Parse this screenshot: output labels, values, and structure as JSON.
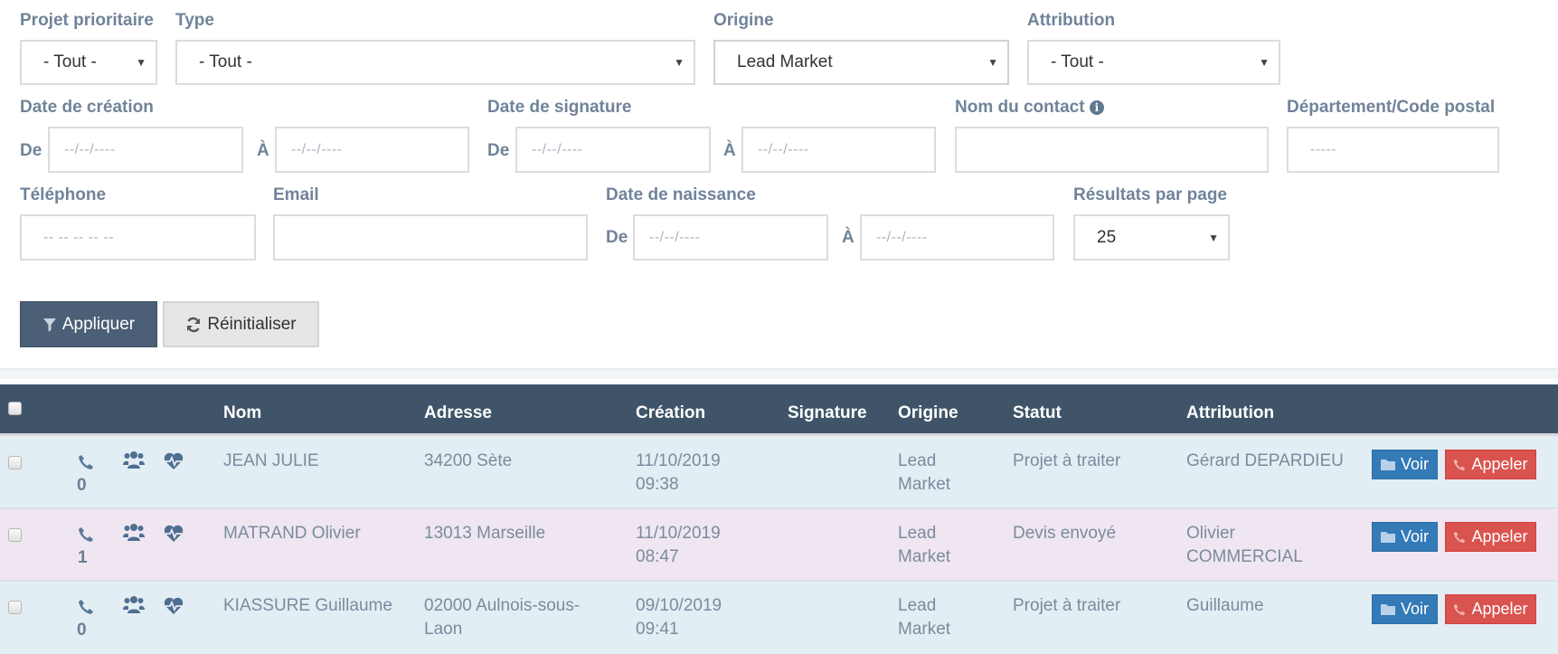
{
  "filters": {
    "projet_prioritaire": {
      "label": "Projet prioritaire",
      "value": "- Tout -"
    },
    "type": {
      "label": "Type",
      "value": "- Tout -"
    },
    "origine": {
      "label": "Origine",
      "value": "Lead Market"
    },
    "attribution": {
      "label": "Attribution",
      "value": "- Tout -"
    },
    "date_creation": {
      "label": "Date de création",
      "from_label": "De",
      "to_label": "À",
      "from_placeholder": "--/--/----",
      "to_placeholder": "--/--/----"
    },
    "date_signature": {
      "label": "Date de signature",
      "from_label": "De",
      "to_label": "À",
      "from_placeholder": "--/--/----",
      "to_placeholder": "--/--/----"
    },
    "nom_contact": {
      "label": "Nom du contact",
      "info_icon": "info-circle-icon",
      "value": ""
    },
    "departement": {
      "label": "Département/Code postal",
      "placeholder": "-----"
    },
    "telephone": {
      "label": "Téléphone",
      "placeholder": "-- -- -- -- --"
    },
    "email": {
      "label": "Email",
      "value": ""
    },
    "date_naissance": {
      "label": "Date de naissance",
      "from_label": "De",
      "to_label": "À",
      "from_placeholder": "--/--/----",
      "to_placeholder": "--/--/----"
    },
    "resultats_par_page": {
      "label": "Résultats par page",
      "value": "25"
    }
  },
  "actions": {
    "apply_label": "Appliquer",
    "reset_label": "Réinitialiser"
  },
  "table": {
    "headers": [
      "Nom",
      "Adresse",
      "Création",
      "Signature",
      "Origine",
      "Statut",
      "Attribution"
    ],
    "rows": [
      {
        "calls": "0",
        "nom": "JEAN JULIE",
        "adresse": "34200 Sète",
        "creation_date": "11/10/2019",
        "creation_time": "09:38",
        "signature": "",
        "origine1": "Lead",
        "origine2": "Market",
        "statut": "Projet à traiter",
        "attribution1": "Gérard DEPARDIEU",
        "attribution2": "",
        "voir": "Voir",
        "appeler": "Appeler"
      },
      {
        "calls": "1",
        "nom": "MATRAND Olivier",
        "adresse": "13013 Marseille",
        "creation_date": "11/10/2019",
        "creation_time": "08:47",
        "signature": "",
        "origine1": "Lead",
        "origine2": "Market",
        "statut": "Devis envoyé",
        "attribution1": "Olivier",
        "attribution2": "COMMERCIAL",
        "voir": "Voir",
        "appeler": "Appeler"
      },
      {
        "calls": "0",
        "nom": "KIASSURE Guillaume",
        "adresse": "02000 Aulnois-sous-",
        "adresse2": "Laon",
        "creation_date": "09/10/2019",
        "creation_time": "09:41",
        "signature": "",
        "origine1": "Lead",
        "origine2": "Market",
        "statut": "Projet à traiter",
        "attribution1": "Guillaume",
        "attribution2": "",
        "voir": "Voir",
        "appeler": "Appeler"
      }
    ]
  },
  "colors": {
    "header_bg": "#3f5468",
    "apply_bg": "#4b6076",
    "voir_bg": "#337ab7",
    "appeler_bg": "#d9534f",
    "row_blue": "#e3edf4",
    "row_pink": "#efe6f1"
  }
}
